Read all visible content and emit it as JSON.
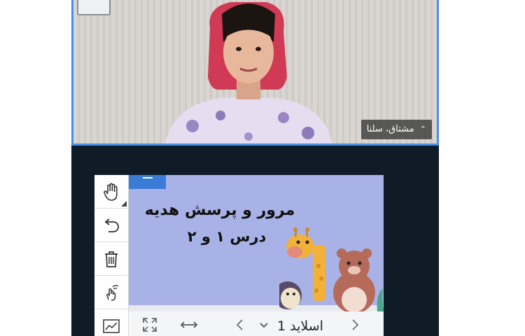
{
  "participant": {
    "name": "مشتاق، سلنا",
    "caret": "⌃"
  },
  "toolbar": {
    "tools": [
      "hand-icon",
      "undo-icon",
      "trash-icon",
      "pointer-hand-icon",
      "line-chart-icon"
    ]
  },
  "slide": {
    "title": "مرور و پرسش هدیه",
    "subtitle": "درس ۱ و ۲"
  },
  "slide_controls": {
    "slide_label": "اسلاید 1",
    "dropdown_icon": "chevron-down-icon",
    "prev_icon": "chevron-left-icon",
    "next_icon": "chevron-right-icon",
    "fit_icon": "expand-icon",
    "width_icon": "fit-width-icon"
  },
  "colors": {
    "background": "#0f1b26",
    "video_border": "#4a8fe6",
    "slide_bg": "#a8b2e6",
    "slide_tab": "#3a7bd5"
  }
}
